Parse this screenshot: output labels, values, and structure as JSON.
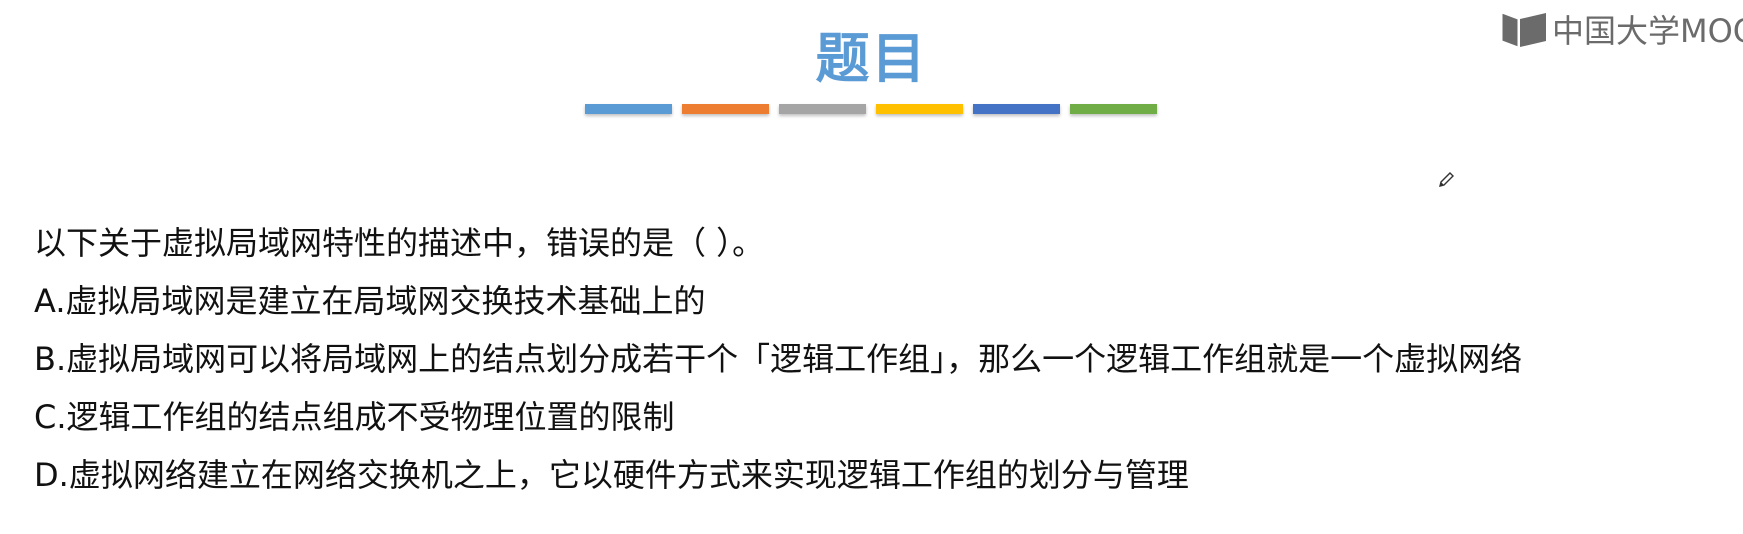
{
  "slide": {
    "title": "题目",
    "bar_colors": [
      "#5b9bd5",
      "#ed7d31",
      "#a5a5a5",
      "#ffc000",
      "#4472c4",
      "#70ad47"
    ],
    "watermark": "中国大学MOOC",
    "watermark_icon": "mooc-book-icon",
    "pen_icon": "pencil-cursor-icon"
  },
  "question": {
    "prompt": "以下关于虚拟局域网特性的描述中，错误的是（ ）。",
    "options": [
      "A.虚拟局域网是建立在局域网交换技术基础上的",
      "B.虚拟局域网可以将局域网上的结点划分成若干个「逻辑工作组」，那么一个逻辑工作组就是一个虚拟网络",
      "C.逻辑工作组的结点组成不受物理位置的限制",
      "D.虚拟网络建立在网络交换机之上，它以硬件方式来实现逻辑工作组的划分与管理"
    ]
  }
}
